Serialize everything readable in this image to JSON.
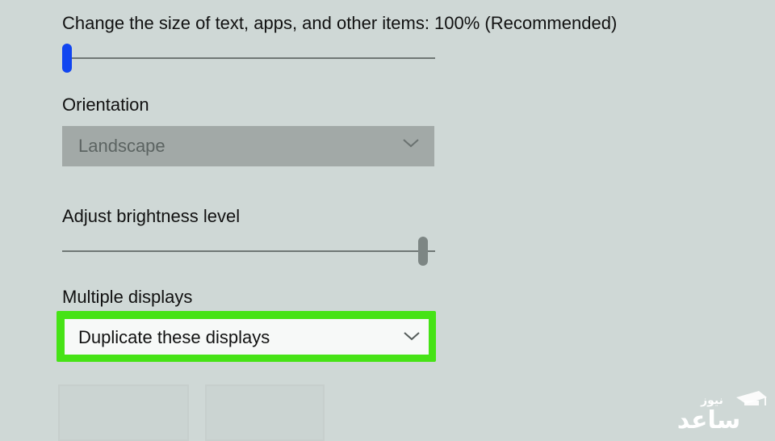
{
  "settings": {
    "scale": {
      "label": "Change the size of text, apps, and other items: 100% (Recommended)",
      "slider_level": 0.0
    },
    "orientation": {
      "label": "Orientation",
      "selected": "Landscape"
    },
    "brightness": {
      "label": "Adjust brightness level",
      "slider_level": 0.98
    },
    "multiple_displays": {
      "label": "Multiple displays",
      "selected": "Duplicate these displays",
      "highlight_color": "#46e316"
    }
  },
  "icons": {
    "dropdown_chevron": "chevron-down-icon",
    "watermark": "graduation-cap-logo"
  },
  "watermark": {
    "text_line1": "نیوز",
    "text_line2": "ساعد"
  },
  "colors": {
    "background": "#cfd8d6",
    "accent": "#1145f0",
    "highlight": "#46e316"
  }
}
